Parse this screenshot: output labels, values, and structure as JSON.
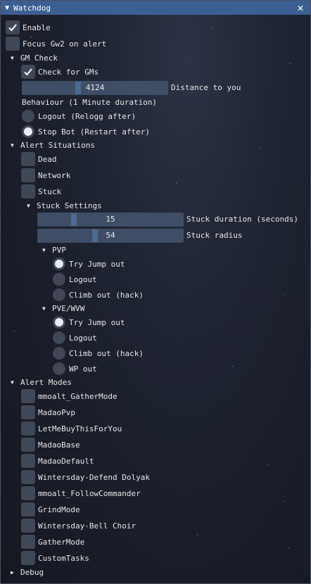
{
  "window": {
    "title": "Watchdog"
  },
  "general": {
    "enable": "Enable",
    "focus_gw2": "Focus Gw2 on alert"
  },
  "gm_check": {
    "header": "GM Check",
    "check_for_gms": "Check for GMs",
    "distance_value": "4124",
    "distance_label": "Distance to you",
    "behaviour_label": "Behaviour (1 Minute duration)",
    "options": [
      "Logout (Relogg after)",
      "Stop Bot (Restart after)"
    ]
  },
  "alert_situations": {
    "header": "Alert Situations",
    "items": [
      "Dead",
      "Network",
      "Stuck"
    ],
    "stuck_settings": {
      "header": "Stuck Settings",
      "duration_value": "15",
      "duration_label": "Stuck duration (seconds)",
      "radius_value": "54",
      "radius_label": "Stuck radius",
      "pvp": {
        "header": "PVP",
        "options": [
          "Try Jump out",
          "Logout",
          "Climb out (hack)"
        ]
      },
      "pve": {
        "header": "PVE/WVW",
        "options": [
          "Try Jump out",
          "Logout",
          "Climb out (hack)",
          "WP out"
        ]
      }
    }
  },
  "alert_modes": {
    "header": "Alert Modes",
    "items": [
      "mmoalt_GatherMode",
      "MadaoPvp",
      "LetMeBuyThisForYou",
      "MadaoBase",
      "MadaoDefault",
      "Wintersday-Defend Dolyak",
      "mmoalt_FollowCommander",
      "GrindMode",
      "Wintersday-Bell Choir",
      "GatherMode",
      "CustomTasks"
    ]
  },
  "debug": {
    "header": "Debug"
  },
  "colors": {
    "title_bar": "#3c5f93",
    "frame_bg": "#3f4856",
    "slider_bg": "#3f4e66",
    "slider_grab": "#4c6a92"
  }
}
